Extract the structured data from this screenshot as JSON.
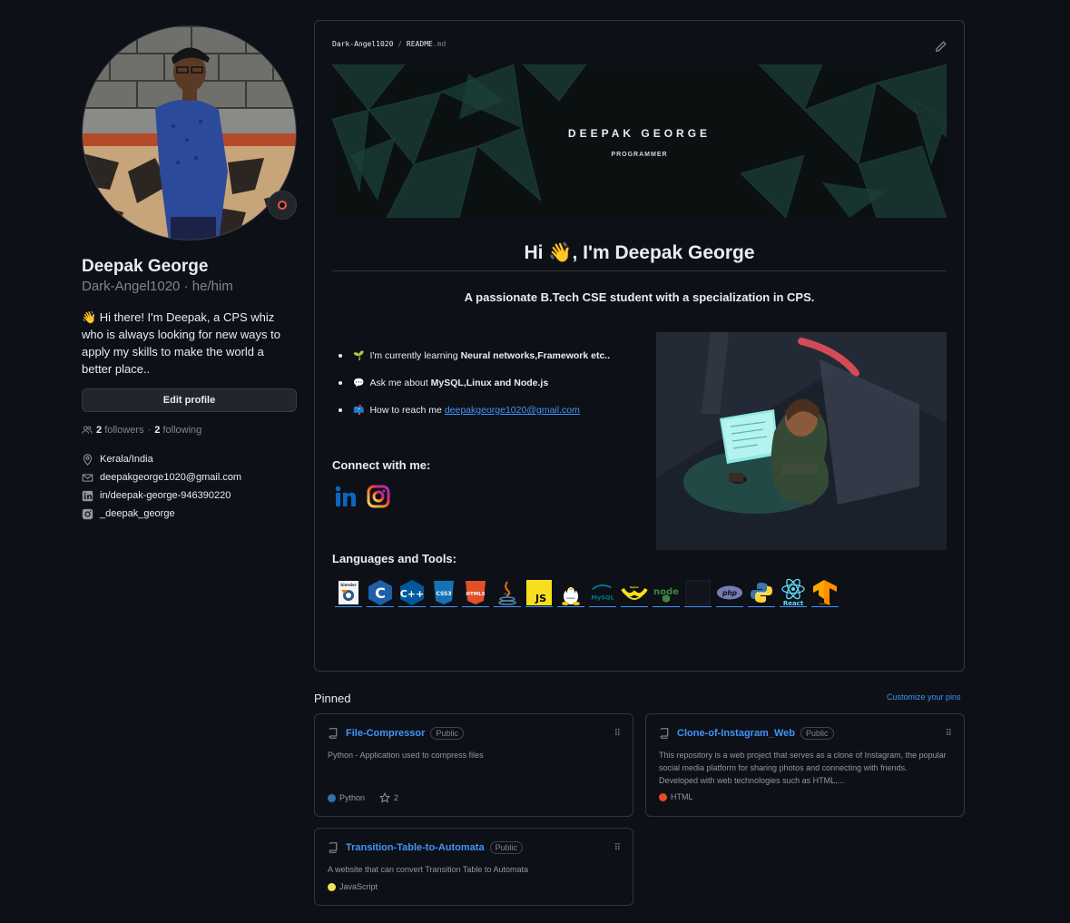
{
  "profile": {
    "name": "Deepak George",
    "login_pronouns": "Dark-Angel1020 · he/him",
    "bio": "👋 Hi there! I'm Deepak, a CPS whiz who is always looking for new ways to apply my skills to make the world a better place..",
    "edit_label": "Edit profile",
    "followers_count": "2",
    "followers_label": "followers",
    "sep": "·",
    "following_count": "2",
    "following_label": "following",
    "location": "Kerala/India",
    "email": "deepakgeorge1020@gmail.com",
    "linkedin": "in/deepak-george-946390220",
    "instagram": "_deepak_george"
  },
  "readme": {
    "owner": "Dark-Angel1020",
    "slash": "/",
    "file": "README",
    "ext": ".md",
    "banner_title": "DEEPAK GEORGE",
    "banner_subtitle": "PROGRAMMER",
    "greeting_pre": "Hi",
    "greeting_emoji": "👋",
    "greeting_post": ", I'm Deepak George",
    "tagline": "A passionate B.Tech CSE student with a specialization in CPS.",
    "bullet1_emoji": "🌱",
    "bullet1_text": "I'm currently learning",
    "bullet1_bold": "Neural networks,Framework etc..",
    "bullet2_emoji": "💬",
    "bullet2_text": "Ask me about",
    "bullet2_bold": "MySQL,Linux and Node.js",
    "bullet3_emoji": "📫",
    "bullet3_text": "How to reach me",
    "bullet3_link": "deepakgeorge1020@gmail.com",
    "connect_title": "Connect with me:",
    "langs_title": "Languages and Tools:",
    "tools": [
      "blender",
      "C",
      "C++",
      "CSS3",
      "HTML5",
      "Java",
      "JS",
      "Linux",
      "MySQL",
      "Nginx",
      "node",
      "",
      "php",
      "Python",
      "React",
      "TensorFlow"
    ]
  },
  "pinned": {
    "title": "Pinned",
    "customize": "Customize your pins",
    "cards": [
      {
        "name": "File-Compressor",
        "badge": "Public",
        "desc": "Python - Application used to compress files",
        "lang": "Python",
        "lang_color": "#3572A5",
        "stars": "2"
      },
      {
        "name": "Clone-of-Instagram_Web",
        "badge": "Public",
        "desc": "This repository is a web project that serves as a clone of Instagram, the popular social media platform for sharing photos and connecting with friends. Developed with web technologies such as HTML,...",
        "lang": "HTML",
        "lang_color": "#e34c26"
      },
      {
        "name": "Transition-Table-to-Automata",
        "badge": "Public",
        "desc": "A website that can convert Transition Table to Automata",
        "lang": "JavaScript",
        "lang_color": "#f1e05a"
      }
    ]
  }
}
